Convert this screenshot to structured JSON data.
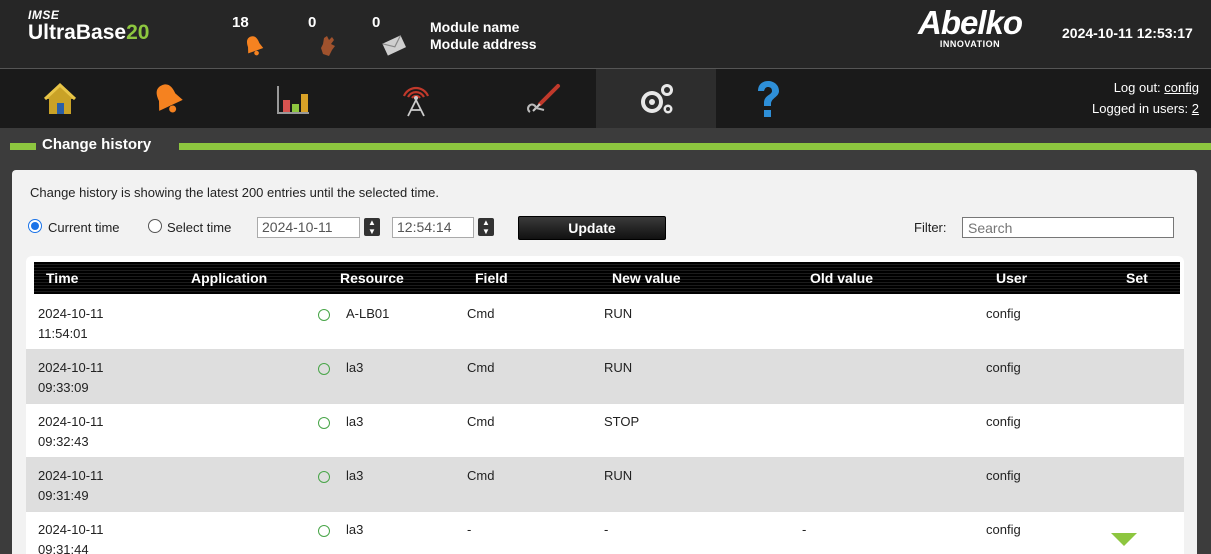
{
  "header": {
    "brand_small": "IMSE",
    "brand_name": "UltraBase",
    "brand_num": "20",
    "alarms": [
      {
        "count": "18",
        "icon": "bell-icon",
        "color": "#f58220"
      },
      {
        "count": "0",
        "icon": "hand-icon",
        "color": "#a0522d"
      },
      {
        "count": "0",
        "icon": "envelope-icon",
        "color": "#cccccc"
      }
    ],
    "module_name": "Module name",
    "module_address": "Module address",
    "logo_name": "Abelko",
    "logo_sub": "INNOVATION",
    "datetime": "2024-10-11 12:53:17"
  },
  "nav": {
    "items": [
      "home-icon",
      "alarm-bell-icon",
      "chart-icon",
      "antenna-icon",
      "tools-icon",
      "settings-gears-icon",
      "help-icon"
    ],
    "logout_prefix": "Log out: ",
    "logout_user": "config",
    "logged_prefix": "Logged in users: ",
    "logged_count": "2"
  },
  "section": {
    "title": "Change history"
  },
  "panel": {
    "info": "Change history is showing the latest 200 entries until the selected time.",
    "current_time_label": "Current time",
    "select_time_label": "Select time",
    "date_value": "2024-10-11",
    "time_value": "12:54:14",
    "update_label": "Update",
    "filter_label": "Filter:",
    "filter_placeholder": "Search"
  },
  "table": {
    "columns": [
      "Time",
      "Application",
      "Resource",
      "Field",
      "New value",
      "Old value",
      "User",
      "Set"
    ],
    "rows": [
      {
        "date": "2024-10-11",
        "time": "11:54:01",
        "application": "",
        "resource": "A-LB01",
        "field": "Cmd",
        "new_value": "RUN",
        "old_value": "",
        "user": "config"
      },
      {
        "date": "2024-10-11",
        "time": "09:33:09",
        "application": "",
        "resource": "la3",
        "field": "Cmd",
        "new_value": "RUN",
        "old_value": "",
        "user": "config"
      },
      {
        "date": "2024-10-11",
        "time": "09:32:43",
        "application": "",
        "resource": "la3",
        "field": "Cmd",
        "new_value": "STOP",
        "old_value": "",
        "user": "config"
      },
      {
        "date": "2024-10-11",
        "time": "09:31:49",
        "application": "",
        "resource": "la3",
        "field": "Cmd",
        "new_value": "RUN",
        "old_value": "",
        "user": "config"
      },
      {
        "date": "2024-10-11",
        "time": "09:31:44",
        "application": "",
        "resource": "la3",
        "field": "-",
        "new_value": "-",
        "old_value": "-",
        "user": "config"
      }
    ]
  },
  "colors": {
    "accent": "#8dc63f",
    "header_bg": "#262626",
    "nav_bg": "#1a1a1a"
  }
}
